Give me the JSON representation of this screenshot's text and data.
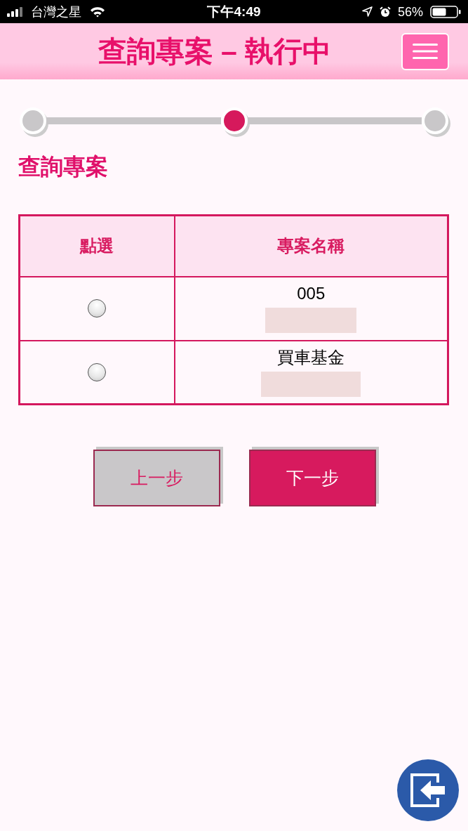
{
  "status_bar": {
    "carrier": "台灣之星",
    "time": "下午4:49",
    "battery": "56%"
  },
  "header": {
    "title": "查詢專案 – 執行中"
  },
  "stepper": {
    "steps": [
      {
        "selected": false
      },
      {
        "selected": true
      },
      {
        "selected": false
      }
    ]
  },
  "section_title": "查詢專案",
  "table": {
    "columns": [
      "點選",
      "專案名稱"
    ],
    "rows": [
      {
        "selected": false,
        "name": "005",
        "masked": true
      },
      {
        "selected": false,
        "name": "買車基金",
        "masked": true
      }
    ]
  },
  "buttons": [
    {
      "kind": "secondary",
      "label": "上一步"
    },
    {
      "kind": "primary",
      "label": "下一步"
    }
  ]
}
